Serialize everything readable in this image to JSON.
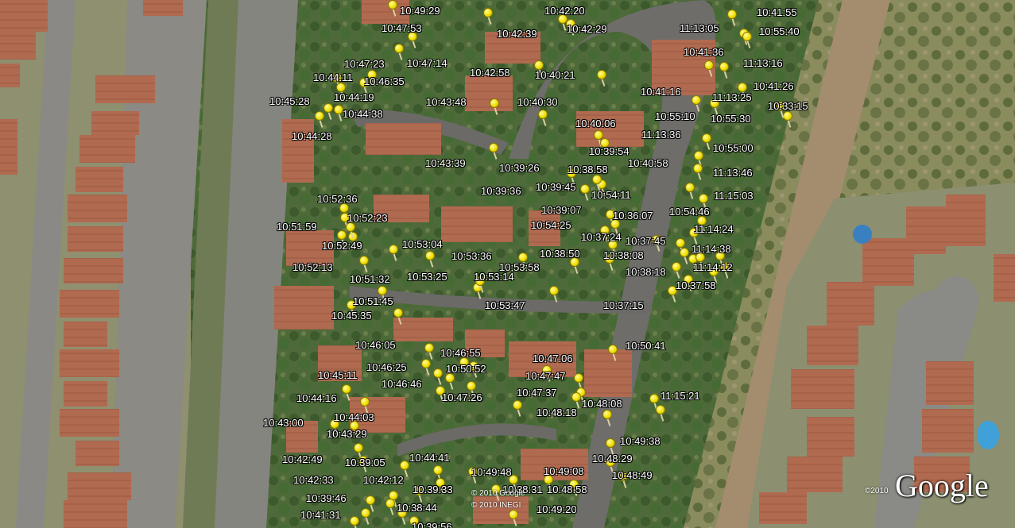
{
  "map": {
    "type": "satellite-imagery",
    "marker_color": "#f4e600",
    "marker_icon": "pushpin-icon",
    "timestamps": [
      "10:49:29",
      "10:42:20",
      "10:41:55",
      "10:47:53",
      "11:13:05",
      "10:55:40",
      "10:42:39",
      "10:42:29",
      "10:47:23",
      "10:47:14",
      "10:41:36",
      "11:13:16",
      "10:44:11",
      "10:46:35",
      "10:42:58",
      "10:40:21",
      "10:41:26",
      "10:45:28",
      "10:44:19",
      "10:43:48",
      "10:40:30",
      "10:41:16",
      "11:13:25",
      "10:33:15",
      "10:44:38",
      "10:55:10",
      "10:55:30",
      "10:40:06",
      "10:44:28",
      "11:13:36",
      "10:39:54",
      "10:55:00",
      "10:43:39",
      "10:39:26",
      "10:38:58",
      "10:40:58",
      "11:13:46",
      "10:39:36",
      "10:39:45",
      "10:54:11",
      "11:15:03",
      "10:52:36",
      "10:52:23",
      "10:39:07",
      "10:36:07",
      "10:54:46",
      "10:51:59",
      "10:54:25",
      "11:14:24",
      "10:52:49",
      "10:53:04",
      "10:37:24",
      "10:37:45",
      "11:14:38",
      "10:53:36",
      "10:38:50",
      "10:38:08",
      "10:52:13",
      "10:53:58",
      "11:14:12",
      "10:38:18",
      "10:51:32",
      "10:53:25",
      "10:53:14",
      "10:37:58",
      "10:51:45",
      "10:53:47",
      "10:37:15",
      "10:45:35",
      "10:46:05",
      "10:46:55",
      "10:50:41",
      "10:47:06",
      "10:45:11",
      "10:46:25",
      "10:50:52",
      "10:47:47",
      "10:46:46",
      "10:44:16",
      "10:47:37",
      "11:15:21",
      "10:47:26",
      "10:48:08",
      "10:44:03",
      "10:48:18",
      "10:43:00",
      "10:43:29",
      "10:49:38",
      "10:42:49",
      "10:39:05",
      "10:44:41",
      "10:48:29",
      "10:49:48",
      "10:49:08",
      "10:42:33",
      "10:42:12",
      "10:48:49",
      "10:39:33",
      "10:38:31",
      "10:48:58",
      "10:39:46",
      "10:38:44",
      "10:49:20",
      "10:41:31",
      "10:39:56"
    ]
  },
  "attribution": {
    "copyright_1": "© 2010 Google",
    "copyright_2": "© 2010 INEGI",
    "logo_year": "©2010",
    "logo_text": "Google"
  }
}
